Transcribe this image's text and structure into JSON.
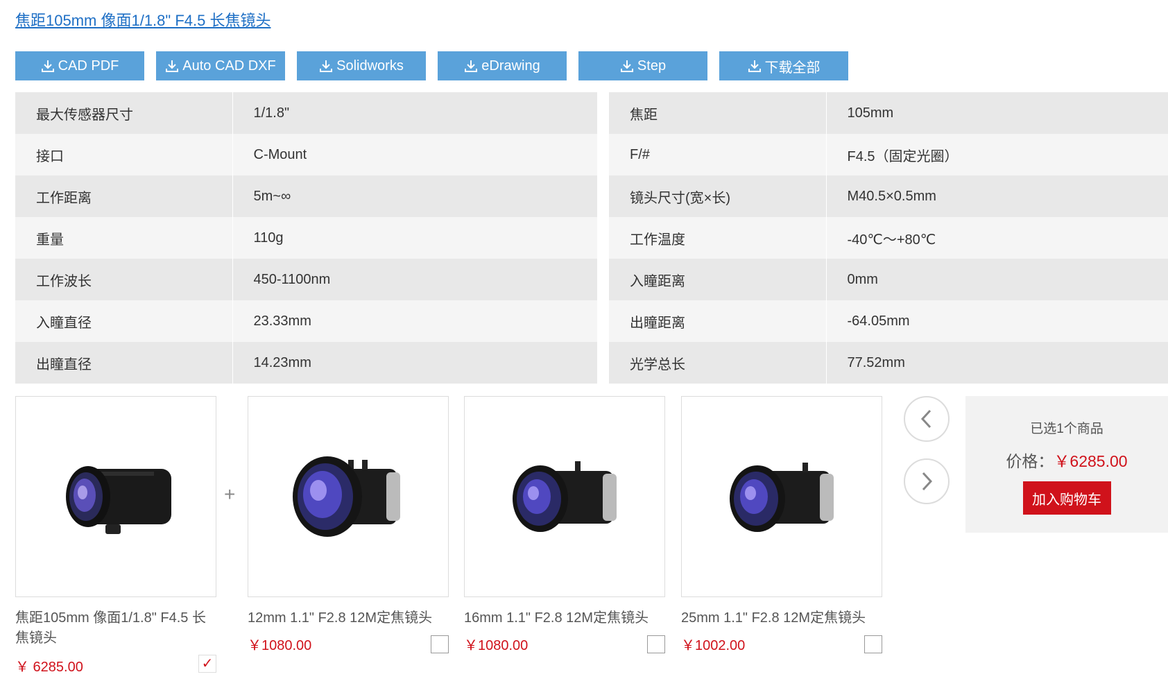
{
  "product_title": "焦距105mm 像面1/1.8\" F4.5 长焦镜头",
  "downloads": [
    {
      "label": "CAD PDF"
    },
    {
      "label": "Auto CAD DXF"
    },
    {
      "label": "Solidworks"
    },
    {
      "label": "eDrawing"
    },
    {
      "label": "Step"
    },
    {
      "label": "下载全部"
    }
  ],
  "specs_left": [
    {
      "k": "最大传感器尺寸",
      "v": "1/1.8\""
    },
    {
      "k": "接口",
      "v": "C-Mount"
    },
    {
      "k": "工作距离",
      "v": "5m~∞"
    },
    {
      "k": "重量",
      "v": "110g"
    },
    {
      "k": "工作波长",
      "v": "450-1100nm"
    },
    {
      "k": "入瞳直径",
      "v": "23.33mm"
    },
    {
      "k": "出瞳直径",
      "v": "14.23mm"
    }
  ],
  "specs_right": [
    {
      "k": "焦距",
      "v": "105mm"
    },
    {
      "k": "F/#",
      "v": "F4.5（固定光圈）"
    },
    {
      "k": "镜头尺寸(宽×长)",
      "v": "M40.5×0.5mm"
    },
    {
      "k": "工作温度",
      "v": "-40℃～+80℃"
    },
    {
      "k": "入瞳距离",
      "v": "0mm"
    },
    {
      "k": "出瞳距离",
      "v": "-64.05mm"
    },
    {
      "k": "光学总长",
      "v": "77.52mm"
    }
  ],
  "products": [
    {
      "name": "焦距105mm 像面1/1.8\" F4.5 长焦镜头",
      "price": "￥ 6285.00",
      "checked": true
    },
    {
      "name": "12mm 1.1\" F2.8 12M定焦镜头",
      "price": "￥1080.00",
      "checked": false
    },
    {
      "name": "16mm 1.1\" F2.8 12M定焦镜头",
      "price": "￥1080.00",
      "checked": false
    },
    {
      "name": "25mm 1.1\" F2.8 12M定焦镜头",
      "price": "￥1002.00",
      "checked": false
    }
  ],
  "plus_sign": "+",
  "summary": {
    "selected_text": "已选1个商品",
    "price_label": "价格：",
    "price_value": "￥6285.00",
    "cart_button": "加入购物车"
  },
  "icons": {
    "download": "download-icon",
    "prev": "chevron-left-icon",
    "next": "chevron-right-icon",
    "check": "checkmark-icon"
  },
  "colors": {
    "accent_blue": "#5aa2da",
    "link_blue": "#1e6fc5",
    "price_red": "#d0121b"
  }
}
